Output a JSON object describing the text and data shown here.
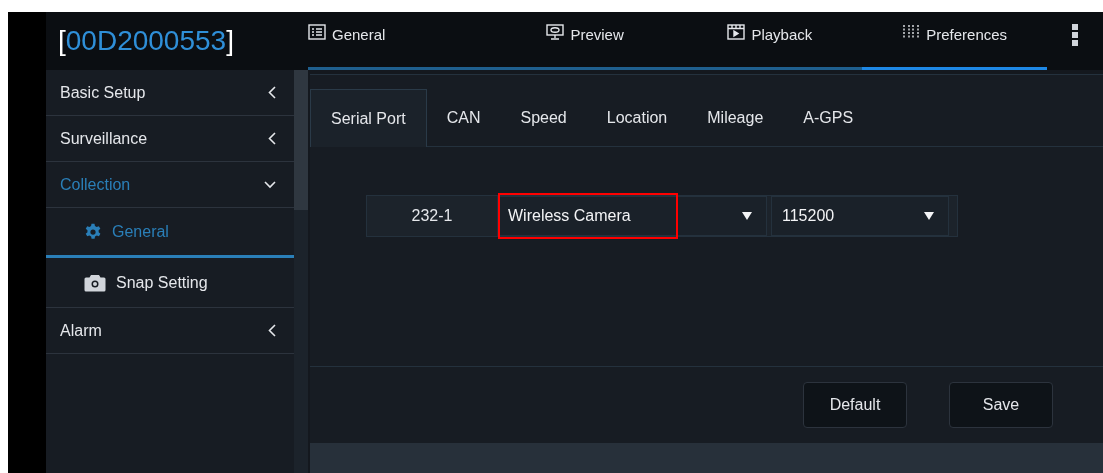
{
  "device_id": {
    "open": "[",
    "id": "00D2000553",
    "close": "]"
  },
  "top_tabs": [
    {
      "label": "General",
      "kind": "grid",
      "selected": false
    },
    {
      "label": "Preview",
      "kind": "monitor",
      "selected": false
    },
    {
      "label": "Playback",
      "kind": "film",
      "selected": false
    },
    {
      "label": "Preferences",
      "kind": "sliders",
      "selected": true
    }
  ],
  "sidebar": {
    "items": [
      {
        "label": "Basic Setup",
        "expanded": false,
        "selected": false
      },
      {
        "label": "Surveillance",
        "expanded": false,
        "selected": false
      },
      {
        "label": "Collection",
        "expanded": true,
        "selected": true,
        "children": [
          {
            "label": "General",
            "kind": "gear",
            "selected": true
          },
          {
            "label": "Snap Setting",
            "kind": "camera",
            "selected": false
          }
        ]
      },
      {
        "label": "Alarm",
        "expanded": false,
        "selected": false
      }
    ]
  },
  "sub_tabs": [
    {
      "label": "Serial Port",
      "selected": true
    },
    {
      "label": "CAN",
      "selected": false
    },
    {
      "label": "Speed",
      "selected": false
    },
    {
      "label": "Location",
      "selected": false
    },
    {
      "label": "Mileage",
      "selected": false
    },
    {
      "label": "A-GPS",
      "selected": false
    }
  ],
  "serial_row": {
    "port": "232-1",
    "device": {
      "value": "Wireless Camera",
      "highlighted": true
    },
    "baud": {
      "value": "115200",
      "highlighted": false
    }
  },
  "buttons": [
    "Default",
    "Save"
  ]
}
